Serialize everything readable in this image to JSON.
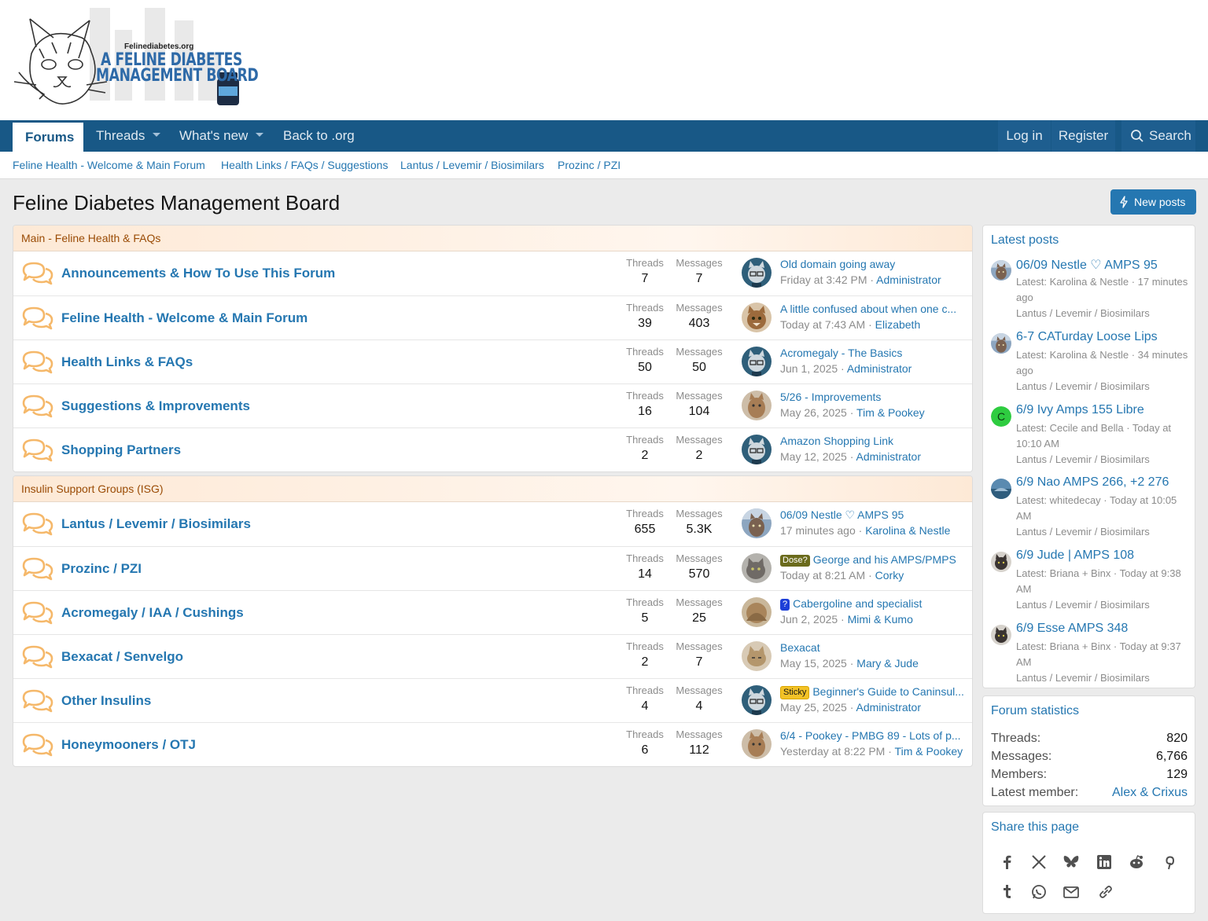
{
  "logo": {
    "small": "Felinediabetes.org",
    "line1": "A FELINE DIABETES",
    "line2": "MANAGEMENT BOARD"
  },
  "nav": {
    "forums": "Forums",
    "threads": "Threads",
    "whats_new": "What's new",
    "back": "Back to .org",
    "login": "Log in",
    "register": "Register",
    "search": "Search"
  },
  "subnav": [
    "Feline Health - Welcome & Main Forum",
    "Health Links / FAQs / Suggestions",
    "Lantus / Levemir / Biosimilars",
    "Prozinc / PZI"
  ],
  "page_title": "Feline Diabetes Management Board",
  "new_posts": "New posts",
  "stat_labels": {
    "threads": "Threads",
    "messages": "Messages"
  },
  "categories": [
    {
      "title": "Main - Feline Health & FAQs",
      "nodes": [
        {
          "title": "Announcements & How To Use This Forum",
          "threads": "7",
          "messages": "7",
          "last_title": "Old domain going away",
          "prefix": "",
          "last_date": "Friday at 3:42 PM",
          "last_user": "Administrator",
          "avatar": "admin"
        },
        {
          "title": "Feline Health - Welcome & Main Forum",
          "threads": "39",
          "messages": "403",
          "last_title": "A little confused about when one c...",
          "prefix": "",
          "last_date": "Today at 7:43 AM",
          "last_user": "Elizabeth",
          "avatar": "cat1"
        },
        {
          "title": "Health Links & FAQs",
          "threads": "50",
          "messages": "50",
          "last_title": "Acromegaly - The Basics",
          "prefix": "",
          "last_date": "Jun 1, 2025",
          "last_user": "Administrator",
          "avatar": "admin"
        },
        {
          "title": "Suggestions & Improvements",
          "threads": "16",
          "messages": "104",
          "last_title": "5/26 - Improvements",
          "prefix": "",
          "last_date": "May 26, 2025",
          "last_user": "Tim & Pookey",
          "avatar": "cat2"
        },
        {
          "title": "Shopping Partners",
          "threads": "2",
          "messages": "2",
          "last_title": "Amazon Shopping Link",
          "prefix": "",
          "last_date": "May 12, 2025",
          "last_user": "Administrator",
          "avatar": "admin"
        }
      ]
    },
    {
      "title": "Insulin Support Groups (ISG)",
      "nodes": [
        {
          "title": "Lantus / Levemir / Biosimilars",
          "threads": "655",
          "messages": "5.3K",
          "last_title": "06/09 Nestle ♡ AMPS 95",
          "prefix": "",
          "last_date": "17 minutes ago",
          "last_user": "Karolina & Nestle",
          "avatar": "cat3"
        },
        {
          "title": "Prozinc / PZI",
          "threads": "14",
          "messages": "570",
          "last_title": "George and his AMPS/PMPS",
          "prefix": "Dose?",
          "last_date": "Today at 8:21 AM",
          "last_user": "Corky",
          "avatar": "cat4"
        },
        {
          "title": "Acromegaly / IAA / Cushings",
          "threads": "5",
          "messages": "25",
          "last_title": "Cabergoline and specialist",
          "prefix": "?",
          "last_date": "Jun 2, 2025",
          "last_user": "Mimi & Kumo",
          "avatar": "cat5"
        },
        {
          "title": "Bexacat / Senvelgo",
          "threads": "2",
          "messages": "7",
          "last_title": "Bexacat",
          "prefix": "",
          "last_date": "May 15, 2025",
          "last_user": "Mary & Jude",
          "avatar": "cat6"
        },
        {
          "title": "Other Insulins",
          "threads": "4",
          "messages": "4",
          "last_title": "Beginner's Guide to Caninsul...",
          "prefix": "Sticky",
          "last_date": "May 25, 2025",
          "last_user": "Administrator",
          "avatar": "admin"
        },
        {
          "title": "Honeymooners / OTJ",
          "threads": "6",
          "messages": "112",
          "last_title": "6/4 - Pookey - PMBG 89 - Lots of p...",
          "prefix": "",
          "last_date": "Yesterday at 8:22 PM",
          "last_user": "Tim & Pookey",
          "avatar": "cat2"
        }
      ]
    }
  ],
  "latest_posts": {
    "title": "Latest posts",
    "items": [
      {
        "title": "06/09 Nestle ♡ AMPS 95",
        "meta": "Latest: Karolina & Nestle · 17 minutes ago",
        "forum": "Lantus / Levemir / Biosimilars",
        "avatar": "cat3"
      },
      {
        "title": "6-7 CATurday Loose Lips",
        "meta": "Latest: Karolina & Nestle · 34 minutes ago",
        "forum": "Lantus / Levemir / Biosimilars",
        "avatar": "cat3"
      },
      {
        "title": "6/9 Ivy Amps 155 Libre",
        "meta": "Latest: Cecile and Bella · Today at 10:10 AM",
        "forum": "Lantus / Levemir / Biosimilars",
        "avatar": "letter-c"
      },
      {
        "title": "6/9 Nao AMPS 266, +2 276",
        "meta": "Latest: whitedecay · Today at 10:05 AM",
        "forum": "Lantus / Levemir / Biosimilars",
        "avatar": "cat7"
      },
      {
        "title": "6/9 Jude | AMPS 108",
        "meta": "Latest: Briana + Binx · Today at 9:38 AM",
        "forum": "Lantus / Levemir / Biosimilars",
        "avatar": "cat8"
      },
      {
        "title": "6/9 Esse AMPS 348",
        "meta": "Latest: Briana + Binx · Today at 9:37 AM",
        "forum": "Lantus / Levemir / Biosimilars",
        "avatar": "cat8"
      }
    ],
    "avatar_letter": "C"
  },
  "forum_stats": {
    "title": "Forum statistics",
    "rows": [
      {
        "label": "Threads:",
        "value": "820"
      },
      {
        "label": "Messages:",
        "value": "6,766"
      },
      {
        "label": "Members:",
        "value": "129"
      },
      {
        "label": "Latest member:",
        "value": "Alex & Crixus"
      }
    ]
  },
  "share": {
    "title": "Share this page",
    "icons": [
      "facebook-icon",
      "x-icon",
      "bluesky-icon",
      "linkedin-icon",
      "reddit-icon",
      "pinterest-icon",
      "tumblr-icon",
      "whatsapp-icon",
      "email-icon",
      "link-icon"
    ]
  },
  "colors": {
    "nav_bg": "#185886",
    "link": "#2577b1",
    "category_text": "#9a4b05",
    "icon_orange": "#f5b86a"
  }
}
